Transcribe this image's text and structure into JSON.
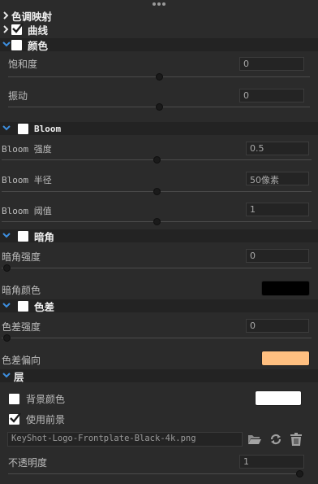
{
  "sections": {
    "color_mapping": {
      "title": "色调映射"
    },
    "curves": {
      "title": "曲线",
      "checked": true
    },
    "color": {
      "title": "颜色",
      "checked": false,
      "saturation": {
        "label": "饱和度",
        "value": "0",
        "level": 0.5
      },
      "vibrance": {
        "label": "振动",
        "value": "0",
        "level": 0.5
      }
    },
    "bloom": {
      "title": "Bloom",
      "checked": false,
      "intensity": {
        "label": "Bloom 强度",
        "value": "0.5",
        "level": 0.5
      },
      "radius": {
        "label": "Bloom 半径",
        "value": "50像素",
        "level": 0.5
      },
      "threshold": {
        "label": "Bloom 阈值",
        "value": "1",
        "level": 0.5
      }
    },
    "vignette": {
      "title": "暗角",
      "checked": false,
      "strength": {
        "label": "暗角强度",
        "value": "0",
        "level": 0.0
      },
      "color": {
        "label": "暗角颜色",
        "swatch": "#000000"
      }
    },
    "chromatic": {
      "title": "色差",
      "checked": false,
      "strength": {
        "label": "色差强度",
        "value": "0",
        "level": 0.0
      },
      "shift": {
        "label": "色差偏向",
        "swatch": "#ffbf80"
      }
    },
    "layers": {
      "title": "层",
      "background_color": {
        "label": "背景颜色",
        "checked": false,
        "swatch": "#ffffff"
      },
      "use_foreground": {
        "label": "使用前景",
        "checked": true
      },
      "file": "KeyShot-Logo-Frontplate-Black-4k.png",
      "icons": [
        "folder-icon",
        "refresh-icon",
        "trash-icon"
      ],
      "opacity": {
        "label": "不透明度",
        "value": "1",
        "level": 1.0
      }
    }
  },
  "colors": {
    "panel": "#2b2b2b",
    "header_band": "#232323",
    "chevron_blue": "#3d8fe0"
  }
}
